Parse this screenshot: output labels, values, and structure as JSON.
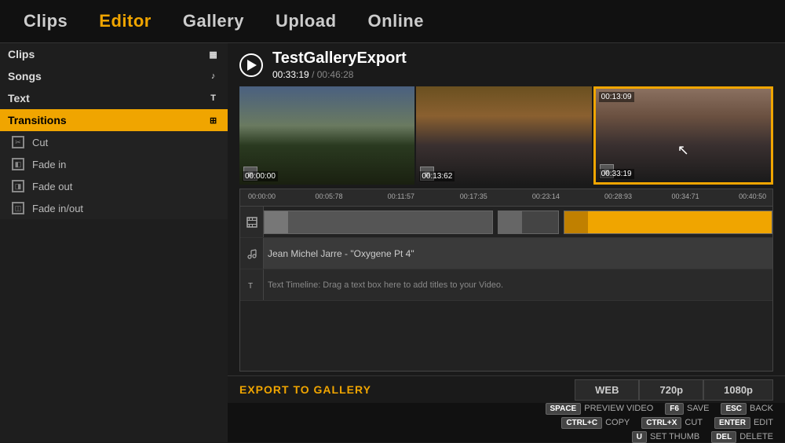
{
  "nav": {
    "items": [
      {
        "label": "Clips",
        "active": false
      },
      {
        "label": "Editor",
        "active": true
      },
      {
        "label": "Gallery",
        "active": false
      },
      {
        "label": "Upload",
        "active": false
      },
      {
        "label": "Online",
        "active": false
      }
    ]
  },
  "sidebar": {
    "categories": [
      {
        "label": "Clips",
        "active": false,
        "icon": "▦"
      },
      {
        "label": "Songs",
        "active": false,
        "icon": "♪"
      },
      {
        "label": "Text",
        "active": false,
        "icon": "T"
      },
      {
        "label": "Transitions",
        "active": true,
        "icon": "⊞"
      }
    ],
    "transitions": [
      {
        "label": "Cut",
        "icon": "✂"
      },
      {
        "label": "Fade in",
        "icon": "◧"
      },
      {
        "label": "Fade out",
        "icon": "◨"
      },
      {
        "label": "Fade in/out",
        "icon": "◫"
      }
    ]
  },
  "preview": {
    "title": "TestGalleryExport",
    "current_time": "00:33:19",
    "total_time": "00:46:28",
    "thumb1_time": "00:00:00",
    "thumb2_time": "00:13:62",
    "thumb3_time": "00:13:09",
    "thumb3_bottom": "00:33:19"
  },
  "timeline": {
    "ruler_marks": [
      {
        "time": "00:00:00",
        "pos": 0
      },
      {
        "time": "00:05:78",
        "pos": 14
      },
      {
        "time": "00:11:57",
        "pos": 28
      },
      {
        "time": "00:17:35",
        "pos": 42
      },
      {
        "time": "00:23:14",
        "pos": 56
      },
      {
        "time": "00:28:93",
        "pos": 70
      },
      {
        "time": "00:34:71",
        "pos": 84
      },
      {
        "time": "00:40:50",
        "pos": 97
      }
    ],
    "audio_label": "Jean Michel Jarre  - \"Oxygene Pt 4\"",
    "text_placeholder": "Text Timeline:  Drag a text box here to add titles to your Video."
  },
  "export": {
    "label": "EXPORT TO GALLERY",
    "options": [
      "WEB",
      "720p",
      "1080p"
    ]
  },
  "shortcuts": {
    "row1": [
      {
        "key": "SPACE",
        "label": "PREVIEW VIDEO"
      },
      {
        "key": "F6",
        "label": "SAVE"
      },
      {
        "key": "ESC",
        "label": "BACK"
      }
    ],
    "row2": [
      {
        "key": "CTRL+C",
        "label": "COPY"
      },
      {
        "key": "CTRL+X",
        "label": "CUT"
      },
      {
        "key": "ENTER",
        "label": "EDIT"
      }
    ],
    "row3": [
      {
        "key": "U",
        "label": "SET THUMB"
      },
      {
        "key": "DEL",
        "label": "DELETE"
      }
    ]
  }
}
